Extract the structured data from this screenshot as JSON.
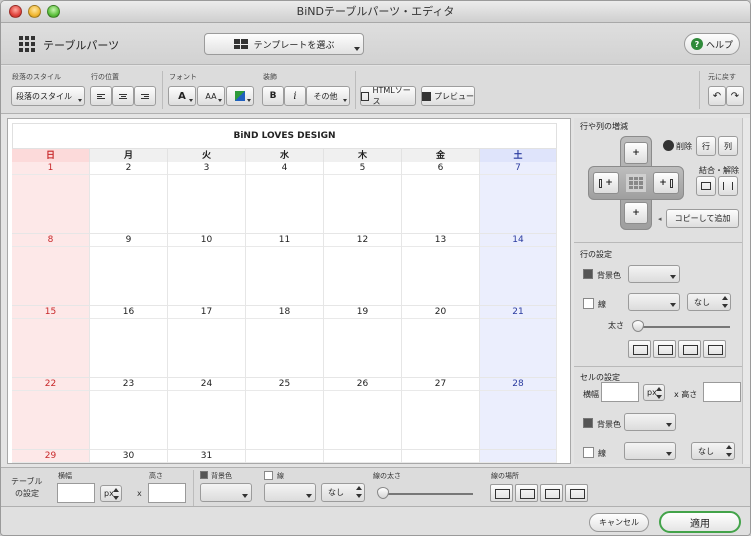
{
  "window": {
    "title": "BiNDテーブルパーツ・エディタ"
  },
  "header": {
    "title": "テーブルパーツ",
    "template_button": "テンプレートを選ぶ",
    "help_button": "ヘルプ"
  },
  "toolbar": {
    "para_style_label": "段落のスタイル",
    "para_style_value": "段落のスタイル",
    "line_pos_label": "行の位置",
    "font_label": "フォント",
    "font_a": "A",
    "font_aa": "AA",
    "deco_label": "装飾",
    "bold": "B",
    "italic": "i",
    "other": "その他",
    "html_source": "HTMLソース",
    "preview": "プレビュー",
    "undo_label": "元に戻す"
  },
  "calendar": {
    "title": "BiND LOVES DESIGN",
    "days": [
      "日",
      "月",
      "火",
      "水",
      "木",
      "金",
      "土"
    ],
    "weeks": [
      [
        "1",
        "2",
        "3",
        "4",
        "5",
        "6",
        "7"
      ],
      [
        "8",
        "9",
        "10",
        "11",
        "12",
        "13",
        "14"
      ],
      [
        "15",
        "16",
        "17",
        "18",
        "19",
        "20",
        "21"
      ],
      [
        "22",
        "23",
        "24",
        "25",
        "26",
        "27",
        "28"
      ],
      [
        "29",
        "30",
        "31",
        "",
        "",
        "",
        ""
      ]
    ]
  },
  "rows_cols": {
    "title": "行や列の増減",
    "delete": "削除",
    "row": "行",
    "col": "列",
    "merge_split": "結合・解除",
    "copy_add": "コピーして追加",
    "plus": "+"
  },
  "row_settings": {
    "title": "行の設定",
    "bg_color": "背景色",
    "line": "線",
    "line_none": "なし",
    "thickness": "太さ"
  },
  "cell_settings": {
    "title": "セルの設定",
    "width": "横幅",
    "unit": "px",
    "height": "x 高さ",
    "bg_color": "背景色",
    "line": "線",
    "line_none": "なし"
  },
  "table_settings": {
    "label_line1": "テーブル",
    "label_line2": "の設定",
    "width": "横幅",
    "height": "高さ",
    "unit": "px",
    "times": "x",
    "bg_color": "背景色",
    "line": "線",
    "line_none": "なし",
    "line_width": "線の太さ",
    "line_place": "線の場所"
  },
  "footer": {
    "cancel": "キャンセル",
    "apply": "適用"
  },
  "colors": {
    "sunday": "#c8282a",
    "saturday": "#2a3b9f",
    "apply_border": "#43a34a",
    "help_icon": "#2f8a3a"
  }
}
